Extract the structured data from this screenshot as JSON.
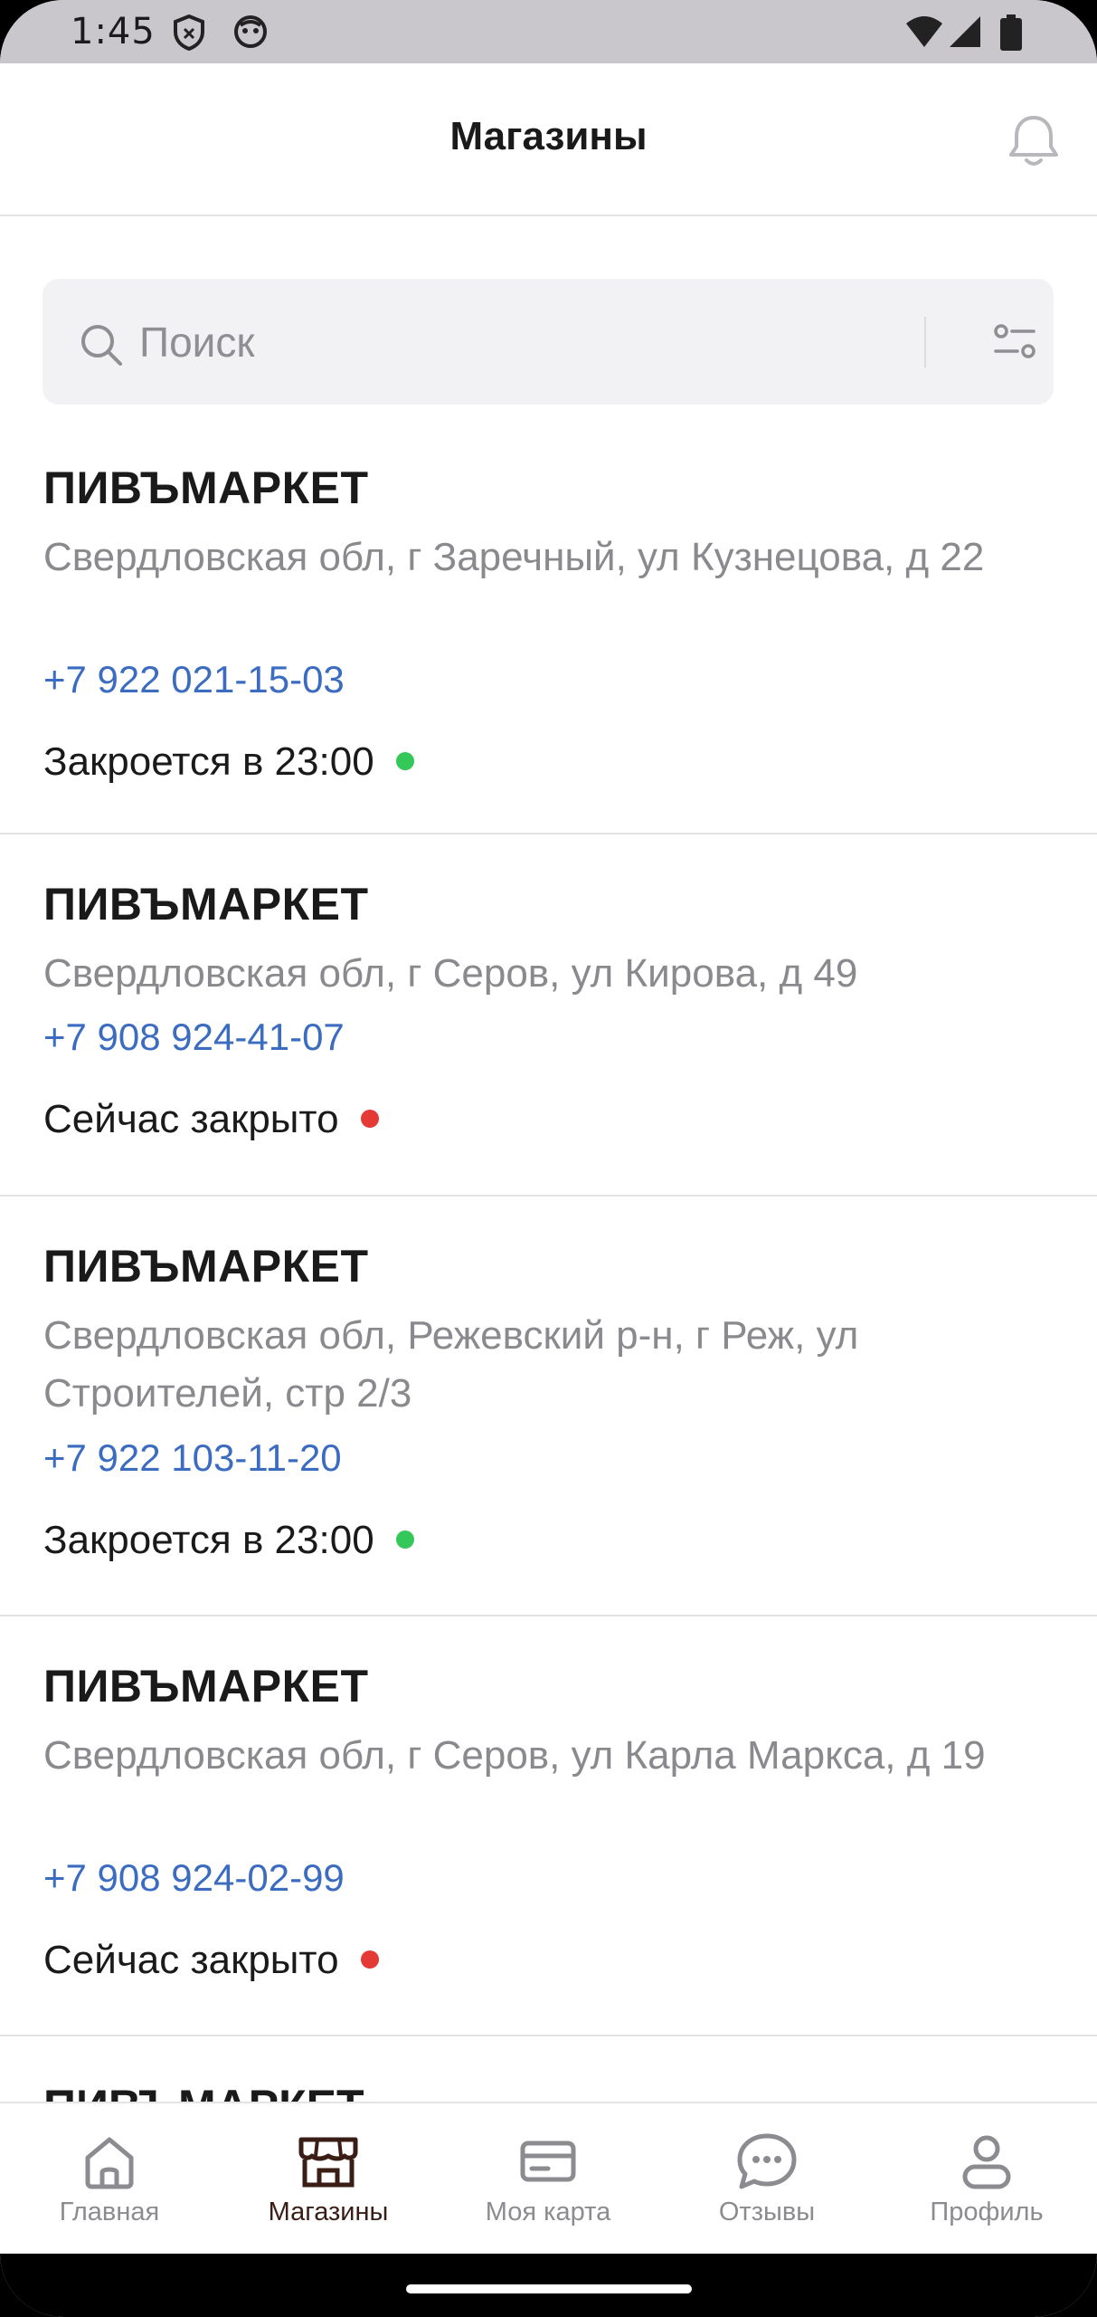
{
  "status_bar": {
    "time": "1:45",
    "icons": [
      "shield-icon",
      "face-icon",
      "wifi-icon",
      "signal-icon",
      "battery-icon"
    ]
  },
  "header": {
    "title": "Магазины",
    "bell_icon": "bell-icon"
  },
  "search": {
    "placeholder": "Поиск",
    "value": "",
    "search_icon": "search-icon",
    "filter_icon": "filter-icon"
  },
  "stores": [
    {
      "name": "ПИВЪМАРКЕТ",
      "address": "Свердловская обл, г Заречный, ул Кузнецова, д 22",
      "phone": "+7 922 021-15-03",
      "status": "Закроется в 23:00",
      "status_color": "#34c759"
    },
    {
      "name": "ПИВЪМАРКЕТ",
      "address": "Свердловская обл, г Серов, ул Кирова, д 49",
      "phone": "+7 908 924-41-07",
      "status": "Сейчас закрыто",
      "status_color": "#e53935"
    },
    {
      "name": "ПИВЪМАРКЕТ",
      "address": "Свердловская обл, Режевский р-н, г Реж, ул Строителей, стр 2/3",
      "phone": "+7 922 103-11-20",
      "status": "Закроется в 23:00",
      "status_color": "#34c759"
    },
    {
      "name": "ПИВЪМАРКЕТ",
      "address": "Свердловская обл, г Серов, ул Карла Маркса, д 19",
      "phone": "+7 908 924-02-99",
      "status": "Сейчас закрыто",
      "status_color": "#e53935"
    },
    {
      "name": "ПИВЪМАРКЕТ"
    }
  ],
  "bottom_nav": {
    "items": [
      {
        "label": "Главная",
        "icon": "home-icon",
        "active": false
      },
      {
        "label": "Магазины",
        "icon": "store-icon",
        "active": true
      },
      {
        "label": "Моя карта",
        "icon": "card-icon",
        "active": false
      },
      {
        "label": "Отзывы",
        "icon": "chat-icon",
        "active": false
      },
      {
        "label": "Профиль",
        "icon": "profile-icon",
        "active": false
      }
    ]
  },
  "colors": {
    "accent": "#3a1e16",
    "link": "#3b6cc0",
    "open": "#34c759",
    "closed": "#e53935"
  }
}
